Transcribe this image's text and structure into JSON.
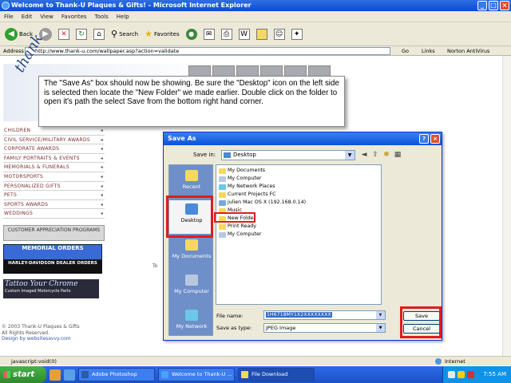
{
  "window": {
    "title": "Welcome to Thank-U Plaques & Gifts! - Microsoft Internet Explorer"
  },
  "menu": [
    "File",
    "Edit",
    "View",
    "Favorites",
    "Tools",
    "Help"
  ],
  "toolbar": {
    "back": "Back",
    "search": "Search",
    "favorites": "Favorites"
  },
  "address": {
    "label": "Address",
    "url": "http://www.thank-u.com/wallpaper.asp?action=validate",
    "go": "Go",
    "links": "Links",
    "norton": "Norton AntiVirus"
  },
  "page": {
    "logo_text": "thank",
    "nav_items": [
      "CHILDREN",
      "CIVIL SERVICE/MILITARY AWARDS",
      "CORPORATE AWARDS",
      "FAMILY PORTRAITS & EVENTS",
      "MEMORIALS & FUNERALS",
      "MOTORSPORTS",
      "PERSONALIZED GIFTS",
      "PETS",
      "SPORTS AWARDS",
      "WEDDINGS"
    ],
    "customer_appreciation": "CUSTOMER APPRECIATION PROGRAMS",
    "memorial_orders": "MEMORIAL ORDERS",
    "harley": "HARLEY-DAVIDSON DEALER ORDERS",
    "tattoo_title": "Tattoo Your Chrome",
    "tattoo_sub": "Custom Imaged Motorcycle Parts",
    "copyright_1": "© 2003 Thank-U Plaques & Gifts",
    "copyright_2": "All Rights Reserved.",
    "design_by": "Design by websitesavvy.com",
    "to_text": "To"
  },
  "callout": {
    "text": "The \"Save As\" box should now be showing. Be sure the \"Desktop\" icon on the left side is selected then locate the \"New Folder\" we made earlier. Double click on the folder to open it's path the select Save from the bottom right hand corner."
  },
  "dialog": {
    "title": "Save As",
    "save_in_label": "Save in:",
    "save_in_value": "Desktop",
    "places": [
      "Recent",
      "Desktop",
      "My Documents",
      "My Computer",
      "My Network"
    ],
    "files": [
      "My Documents",
      "My Computer",
      "My Network Places",
      "Current Projects FC",
      "julien Mac OS X (192.168.0.14)",
      "Music",
      "New Folder",
      "Print Ready",
      "My Computer"
    ],
    "file_name_label": "File name:",
    "file_name_value": "1H6718MY1X2XXXXXXXX",
    "save_type_label": "Save as type:",
    "save_type_value": "JPEG Image",
    "save_button": "Save",
    "cancel_button": "Cancel"
  },
  "status": {
    "text": "javascript:void(0)",
    "zone": "Internet"
  },
  "taskbar": {
    "start": "start",
    "tasks": [
      "Adobe Photoshop",
      "Welcome to Thank-U ...",
      "File Download"
    ],
    "clock": "7:55 AM"
  }
}
